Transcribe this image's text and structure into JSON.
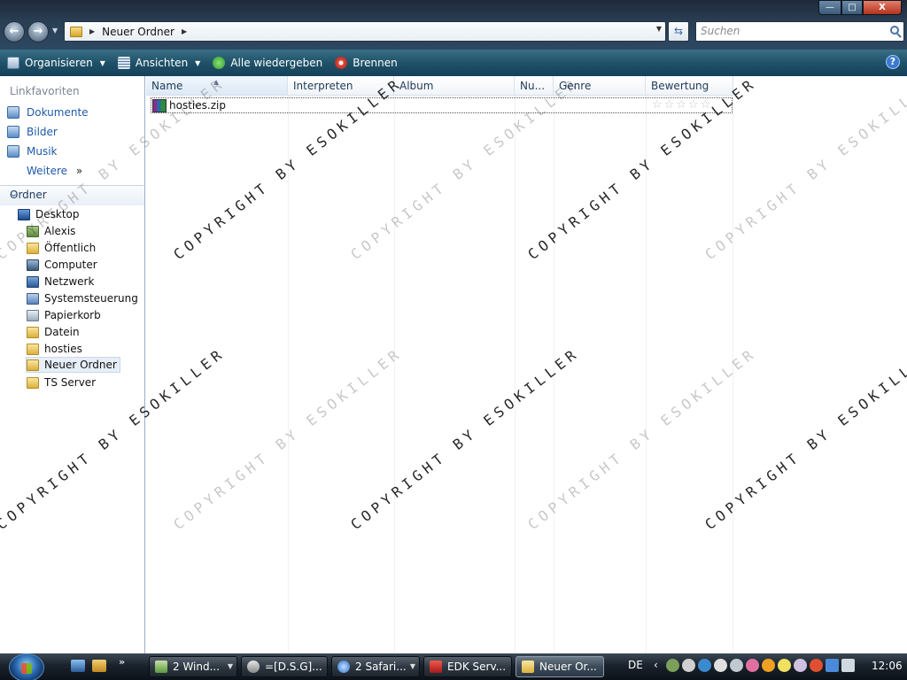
{
  "window": {
    "min_glyph": "—",
    "max_glyph": "□",
    "close_glyph": "X"
  },
  "nav": {
    "back_glyph": "←",
    "forward_glyph": "→"
  },
  "address": {
    "path": "Neuer Ordner"
  },
  "search": {
    "placeholder": "Suchen"
  },
  "commands": {
    "organize": "Organisieren",
    "views": "Ansichten",
    "play_all": "Alle wiedergeben",
    "burn": "Brennen",
    "help": "?"
  },
  "navpane": {
    "favorites_header": "Linkfavoriten",
    "favorites": [
      "Dokumente",
      "Bilder",
      "Musik"
    ],
    "more": "Weitere",
    "folders_header": "Ordner",
    "tree": [
      "Desktop",
      "Alexis",
      "Öffentlich",
      "Computer",
      "Netzwerk",
      "Systemsteuerung",
      "Papierkorb",
      "Datein",
      "hosties",
      "Neuer Ordner",
      "TS Server"
    ]
  },
  "columns": [
    "Name",
    "Interpreten",
    "Album",
    "Nu...",
    "Genre",
    "Bewertung"
  ],
  "files": [
    {
      "name": "hosties.zip",
      "rating": 0
    }
  ],
  "watermark": "COPYRIGHT BY ESOKILLER",
  "taskbar": {
    "tasks": [
      "2 Wind...",
      "=[D.S.G]...",
      "2 Safari...",
      "EDK Serv...",
      "Neuer Or..."
    ],
    "language": "DE",
    "clock": "12:06"
  },
  "colors": {
    "link": "#1e5aa8",
    "cmdbar": "#1f5268",
    "titlebar": "#1e2a3a"
  }
}
